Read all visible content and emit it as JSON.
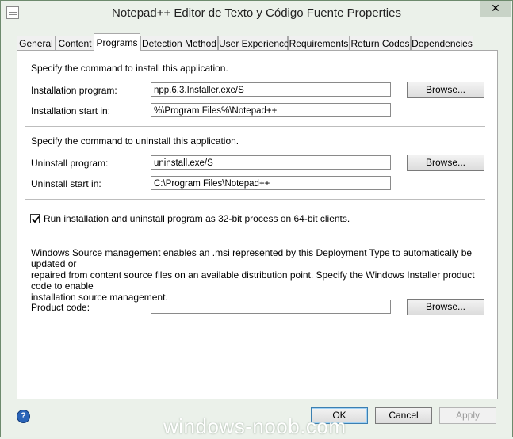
{
  "window": {
    "title": "Notepad++ Editor de Texto y Código Fuente Properties",
    "close_glyph": "✕"
  },
  "tabs": [
    {
      "label": "General"
    },
    {
      "label": "Content"
    },
    {
      "label": "Programs",
      "active": true
    },
    {
      "label": "Detection Method"
    },
    {
      "label": "User Experience"
    },
    {
      "label": "Requirements"
    },
    {
      "label": "Return Codes"
    },
    {
      "label": "Dependencies"
    }
  ],
  "install": {
    "heading": "Specify the command to install this application.",
    "program_label": "Installation program:",
    "program_value": "npp.6.3.Installer.exe/S",
    "start_label": "Installation start in:",
    "start_value": "%\\Program Files%\\Notepad++",
    "browse_label": "Browse..."
  },
  "uninstall": {
    "heading": "Specify the command to uninstall this application.",
    "program_label": "Uninstall program:",
    "program_value": "uninstall.exe/S",
    "start_label": "Uninstall start in:",
    "start_value": "C:\\Program Files\\Notepad++",
    "browse_label": "Browse..."
  },
  "run32": {
    "label": "Run installation and uninstall program as 32-bit process on 64-bit clients.",
    "checked": true
  },
  "source_mgmt": {
    "description": "Windows Source management enables an .msi represented by this Deployment Type to automatically be updated or repaired from content source files on an available distribution point. Specify the Windows Installer product code to enable installation source management.",
    "line1": "Windows Source management enables an .msi represented by this Deployment Type to automatically be updated or",
    "line2": "repaired from content source files on an available distribution point. Specify the Windows Installer product code to enable",
    "line3": "installation source management.",
    "product_code_label": "Product code:",
    "product_code_value": "",
    "browse_label": "Browse..."
  },
  "footer": {
    "help_glyph": "?",
    "ok_label": "OK",
    "cancel_label": "Cancel",
    "apply_label": "Apply"
  },
  "watermark": "windows-noob.com",
  "colors": {
    "window_bg": "#ebf1ea",
    "panel_bg": "#ffffff",
    "ok_border": "#3c7fb1",
    "help_blue": "#2a64b8"
  }
}
